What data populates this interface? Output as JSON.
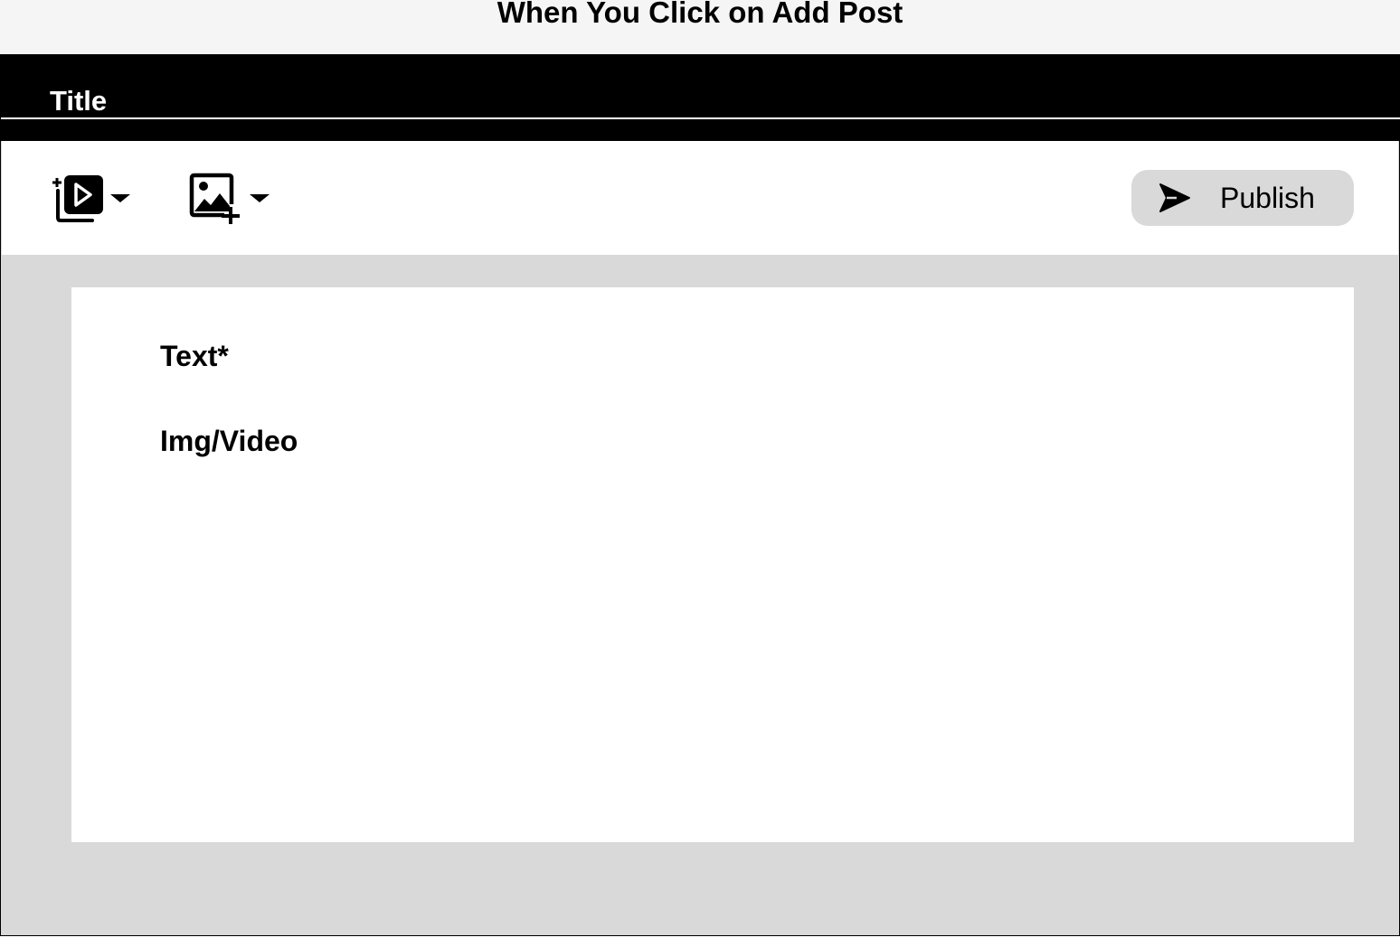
{
  "caption": "When You Click on Add Post",
  "header": {
    "title": "Title"
  },
  "toolbar": {
    "tools": [
      {
        "icon": "add-video-icon"
      },
      {
        "icon": "add-image-icon"
      }
    ],
    "publish_label": "Publish",
    "publish_icon": "send-icon"
  },
  "editor": {
    "text_label": "Text*",
    "media_label": "Img/Video"
  },
  "colors": {
    "header_bg": "#000000",
    "canvas_bg": "#d9d9d9",
    "button_bg": "#d9d9d9",
    "panel_bg": "#ffffff"
  }
}
